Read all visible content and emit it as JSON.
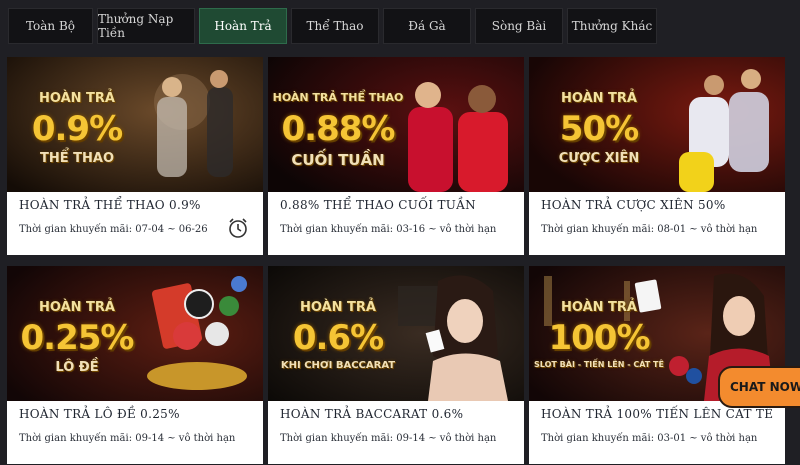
{
  "tabs": [
    {
      "label": "Toàn Bộ",
      "active": false
    },
    {
      "label": "Thưởng Nạp Tiền",
      "active": false
    },
    {
      "label": "Hoàn Trả",
      "active": true
    },
    {
      "label": "Thể Thao",
      "active": false
    },
    {
      "label": "Đá Gà",
      "active": false
    },
    {
      "label": "Sòng Bài",
      "active": false
    },
    {
      "label": "Thưởng Khác",
      "active": false
    }
  ],
  "cards": [
    {
      "banner": {
        "line1": "HOÀN TRẢ",
        "big": "0.9%",
        "line3": "THỂ THAO"
      },
      "title": "HOÀN TRẢ THỂ THAO 0.9%",
      "period": "Thời gian khuyến mãi: 07-04 ~ 06-26",
      "has_clock_icon": true
    },
    {
      "banner": {
        "line1": "HOÀN TRẢ THỂ THAO",
        "big": "0.88%",
        "line3": "CUỐI TUẦN"
      },
      "title": "0.88% THỂ THAO CUỐI TUẦN",
      "period": "Thời gian khuyến mãi: 03-16 ~ vô thời hạn",
      "has_clock_icon": false
    },
    {
      "banner": {
        "line1": "HOÀN TRẢ",
        "big": "50%",
        "line3": "CƯỢC XIÊN"
      },
      "title": "HOÀN TRẢ CƯỢC XIÊN 50%",
      "period": "Thời gian khuyến mãi: 08-01 ~ vô thời hạn",
      "has_clock_icon": false
    },
    {
      "banner": {
        "line1": "HOÀN TRẢ",
        "big": "0.25%",
        "line3": "LÔ ĐỀ"
      },
      "title": "HOÀN TRẢ LÔ ĐỀ 0.25%",
      "period": "Thời gian khuyến mãi: 09-14 ~ vô thời hạn",
      "has_clock_icon": false
    },
    {
      "banner": {
        "line1": "HOÀN TRẢ",
        "big": "0.6%",
        "line3": "KHI CHƠI BACCARAT"
      },
      "title": "HOÀN TRẢ BACCARAT 0.6%",
      "period": "Thời gian khuyến mãi: 09-14 ~ vô thời hạn",
      "has_clock_icon": false
    },
    {
      "banner": {
        "line1": "HOÀN TRẢ",
        "big": "100%",
        "line3": "SLOT BÀI - TIẾN LÊN - CÁT TÊ"
      },
      "title": "HOÀN TRẢ 100% TIẾN LÊN CÁT TÊ",
      "period": "Thời gian khuyến mãi: 03-01 ~ vô thời hạn",
      "has_clock_icon": false
    }
  ],
  "chat": {
    "label": "CHAT NOW"
  },
  "colors": {
    "background": "#1f1f24",
    "active_tab": "#1f4a33",
    "gold": "#f5c535",
    "chat": "#f38b2e"
  }
}
